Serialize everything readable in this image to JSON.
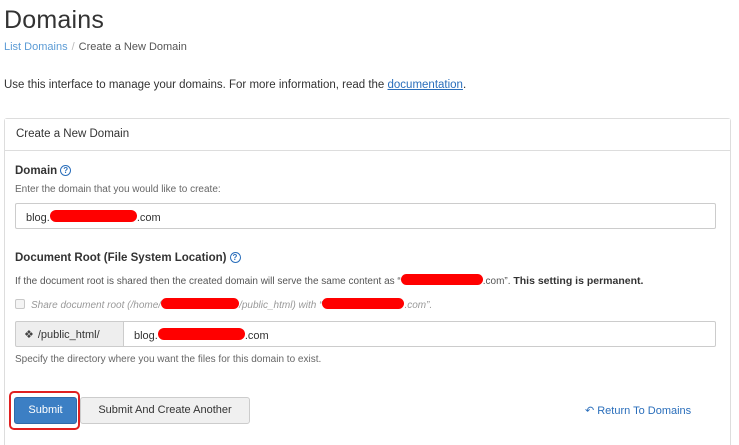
{
  "page": {
    "title": "Domains",
    "breadcrumb": {
      "link": "List Domains",
      "separator": "/",
      "current": "Create a New Domain"
    },
    "intro": {
      "text": "Use this interface to manage your domains. For more information, read the ",
      "link": "documentation",
      "after": "."
    }
  },
  "panel": {
    "heading": "Create a New Domain",
    "domain": {
      "label": "Domain",
      "help": "?",
      "hint": "Enter the domain that you would like to create:",
      "value_prefix": "blog.",
      "value_suffix": ".com"
    },
    "docroot": {
      "label": "Document Root (File System Location)",
      "help": "?",
      "hint_prefix": "If the document root is shared then the created domain will serve the same content as “",
      "hint_suffix": ".com”.",
      "hint_bold": "This setting is permanent.",
      "share_prefix": "Share document root (/home/",
      "share_middle": "/public_html) with “",
      "share_suffix": ".com”.",
      "addon": "/public_html/",
      "value_prefix": "blog.",
      "value_suffix": ".com",
      "footer_hint": "Specify the directory where you want the files for this domain to exist."
    }
  },
  "actions": {
    "submit": "Submit",
    "submit_another": "Submit And Create Another",
    "return": "Return To Domains"
  },
  "colors": {
    "primary": "#3c7fc4",
    "link": "#2a6ebb",
    "redaction": "#ff0000",
    "focus": "#e02020"
  }
}
